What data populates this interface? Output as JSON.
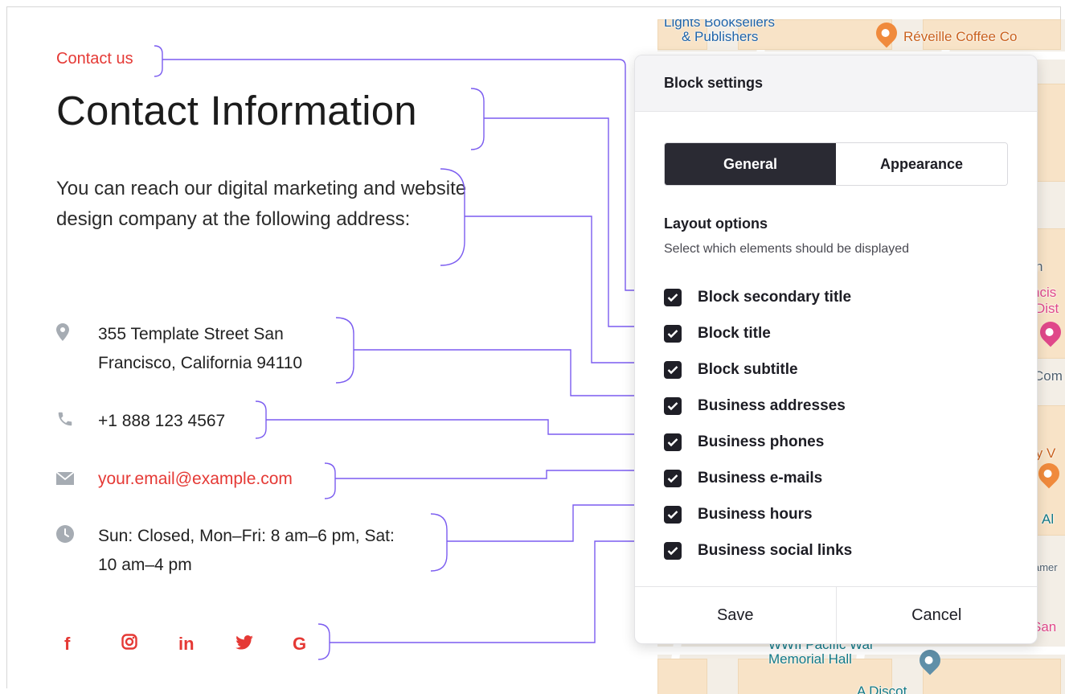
{
  "left": {
    "secondary_title": "Contact us",
    "title": "Contact Information",
    "subtitle": "You can reach our digital marketing and website design company at the following address:",
    "address_line1": "355 Template Street San",
    "address_line2": "Francisco, California 94110",
    "phone": "+1 888 123 4567",
    "email": "your.email@example.com",
    "hours_line1": "Sun: Closed, Mon–Fri: 8 am–6 pm, Sat:",
    "hours_line2": "10 am–4 pm",
    "social_icons": [
      "facebook-icon",
      "instagram-icon",
      "linkedin-icon",
      "twitter-icon",
      "google-icon"
    ],
    "accent_color": "#e53935"
  },
  "map": {
    "labels": {
      "booksellers_1": "Lights Booksellers",
      "booksellers_2": "& Publishers",
      "cafe": "Réveille Coffee Co",
      "memorial_1": "WWII Pacific War",
      "memorial_2": "Memorial Hall",
      "edge_n": "n",
      "edge_ncis": "ncis",
      "edge_dist": "Dist",
      "edge_com": "Com",
      "edge_tyv": "ty V",
      "edge_al": "Al",
      "edge_amer": "amer",
      "edge_san": "San",
      "bottom_partial": "A   Discot"
    }
  },
  "panel": {
    "title": "Block settings",
    "tabs": [
      {
        "label": "General",
        "active": true
      },
      {
        "label": "Appearance",
        "active": false
      }
    ],
    "layout_title": "Layout options",
    "layout_desc": "Select which elements should be displayed",
    "options": [
      {
        "label": "Block secondary title",
        "checked": true
      },
      {
        "label": "Block title",
        "checked": true
      },
      {
        "label": "Block subtitle",
        "checked": true
      },
      {
        "label": "Business addresses",
        "checked": true
      },
      {
        "label": "Business phones",
        "checked": true
      },
      {
        "label": "Business e-mails",
        "checked": true
      },
      {
        "label": "Business hours",
        "checked": true
      },
      {
        "label": "Business social links",
        "checked": true
      }
    ],
    "save_label": "Save",
    "cancel_label": "Cancel",
    "dark_color": "#2a2a33"
  },
  "callout_color": "#7b5cf0"
}
